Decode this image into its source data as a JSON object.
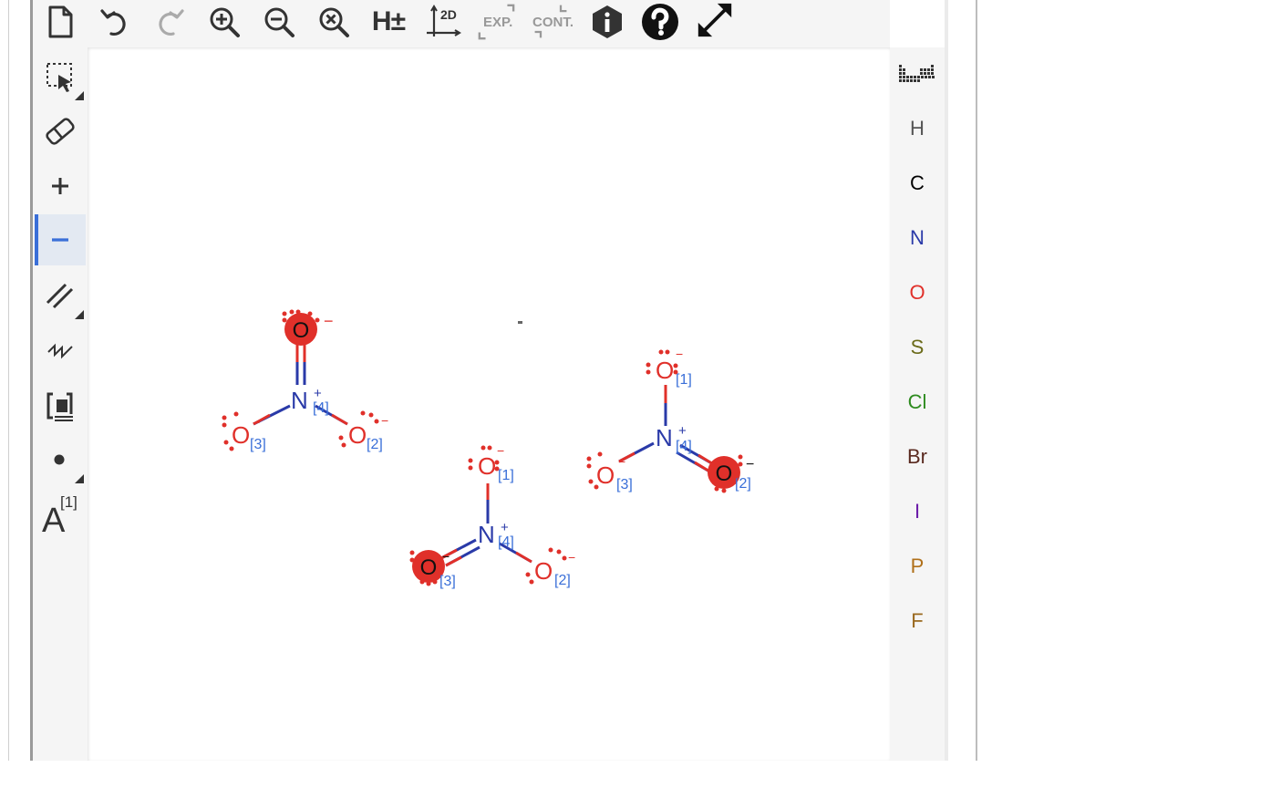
{
  "toolbar": {
    "hplus_label": "H±",
    "twod_label": "2D",
    "exp_label": "EXP.",
    "cont_label": "CONT."
  },
  "left_tools": {
    "atom_label_letter": "A",
    "atom_label_index": "[1]"
  },
  "atom_palette": [
    {
      "symbol": "H",
      "color": "#555555"
    },
    {
      "symbol": "C",
      "color": "#000000"
    },
    {
      "symbol": "N",
      "color": "#2a3aa8"
    },
    {
      "symbol": "O",
      "color": "#e0302a"
    },
    {
      "symbol": "S",
      "color": "#6b6b1a"
    },
    {
      "symbol": "Cl",
      "color": "#2e8b1f"
    },
    {
      "symbol": "Br",
      "color": "#5a2a20"
    },
    {
      "symbol": "I",
      "color": "#6a1aa8"
    },
    {
      "symbol": "P",
      "color": "#b0701a"
    },
    {
      "symbol": "F",
      "color": "#9a6a20"
    }
  ],
  "molecules": {
    "n_symbol": "N",
    "o_symbol": "O",
    "plus": "+",
    "minus": "−",
    "map_n": "[4]",
    "map_o1": "[1]",
    "map_o2": "[2]",
    "map_o3": "[3]"
  },
  "colors": {
    "accent": "#3a6fd8",
    "oxygen": "#e0302a",
    "nitrogen": "#2a3aa8",
    "mapnum": "#3a6fd8"
  }
}
